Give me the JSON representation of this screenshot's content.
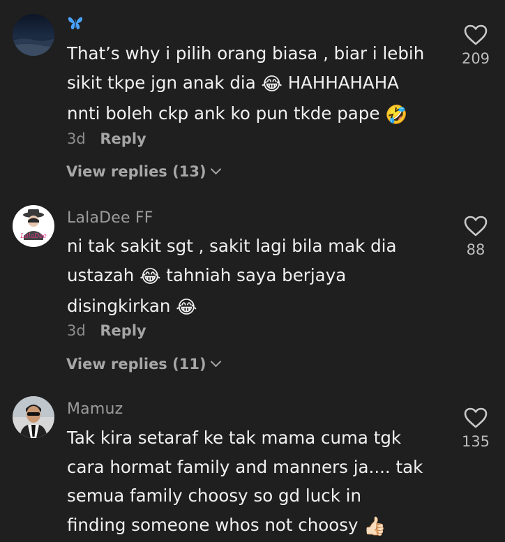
{
  "comments": [
    {
      "username": "🦋",
      "lines": [
        {
          "text": "That’s why i pilih orang biasa , biar i lebih",
          "emoji": "",
          "after": ""
        },
        {
          "text": "sikit tkpe jgn anak dia ",
          "emoji": "😂",
          "after": " HAHHAHAHA"
        },
        {
          "text": "nnti boleh ckp ank ko pun tkde pape ",
          "emoji": "🤣",
          "after": ""
        }
      ],
      "time": "3d",
      "reply_label": "Reply",
      "view_replies": "View replies (13)",
      "likes": "209"
    },
    {
      "username": "LalaDee FF",
      "lines": [
        {
          "text": "ni tak sakit sgt , sakit lagi bila mak dia",
          "emoji": "",
          "after": ""
        },
        {
          "text": "ustazah ",
          "emoji": "😂",
          "after": " tahniah saya berjaya"
        },
        {
          "text": "disingkirkan ",
          "emoji": "😂",
          "after": ""
        }
      ],
      "time": "3d",
      "reply_label": "Reply",
      "view_replies": "View replies (11)",
      "likes": "88",
      "avatar_text": "LalaDee"
    },
    {
      "username": "Mamuz",
      "lines": [
        {
          "text": "Tak kira setaraf ke tak mama cuma tgk",
          "emoji": "",
          "after": ""
        },
        {
          "text": "cara hormat family and manners ja.... tak",
          "emoji": "",
          "after": ""
        },
        {
          "text": "semua family choosy so gd luck in",
          "emoji": "",
          "after": ""
        },
        {
          "text": "finding someone whos not choosy ",
          "emoji": "👍🏻",
          "after": ""
        }
      ],
      "likes": "135"
    }
  ],
  "colors": {
    "background": "#1f1f1f",
    "username": "#9c9c9c",
    "text": "#f1f1f1",
    "butterfly": "#4aa3ff"
  }
}
